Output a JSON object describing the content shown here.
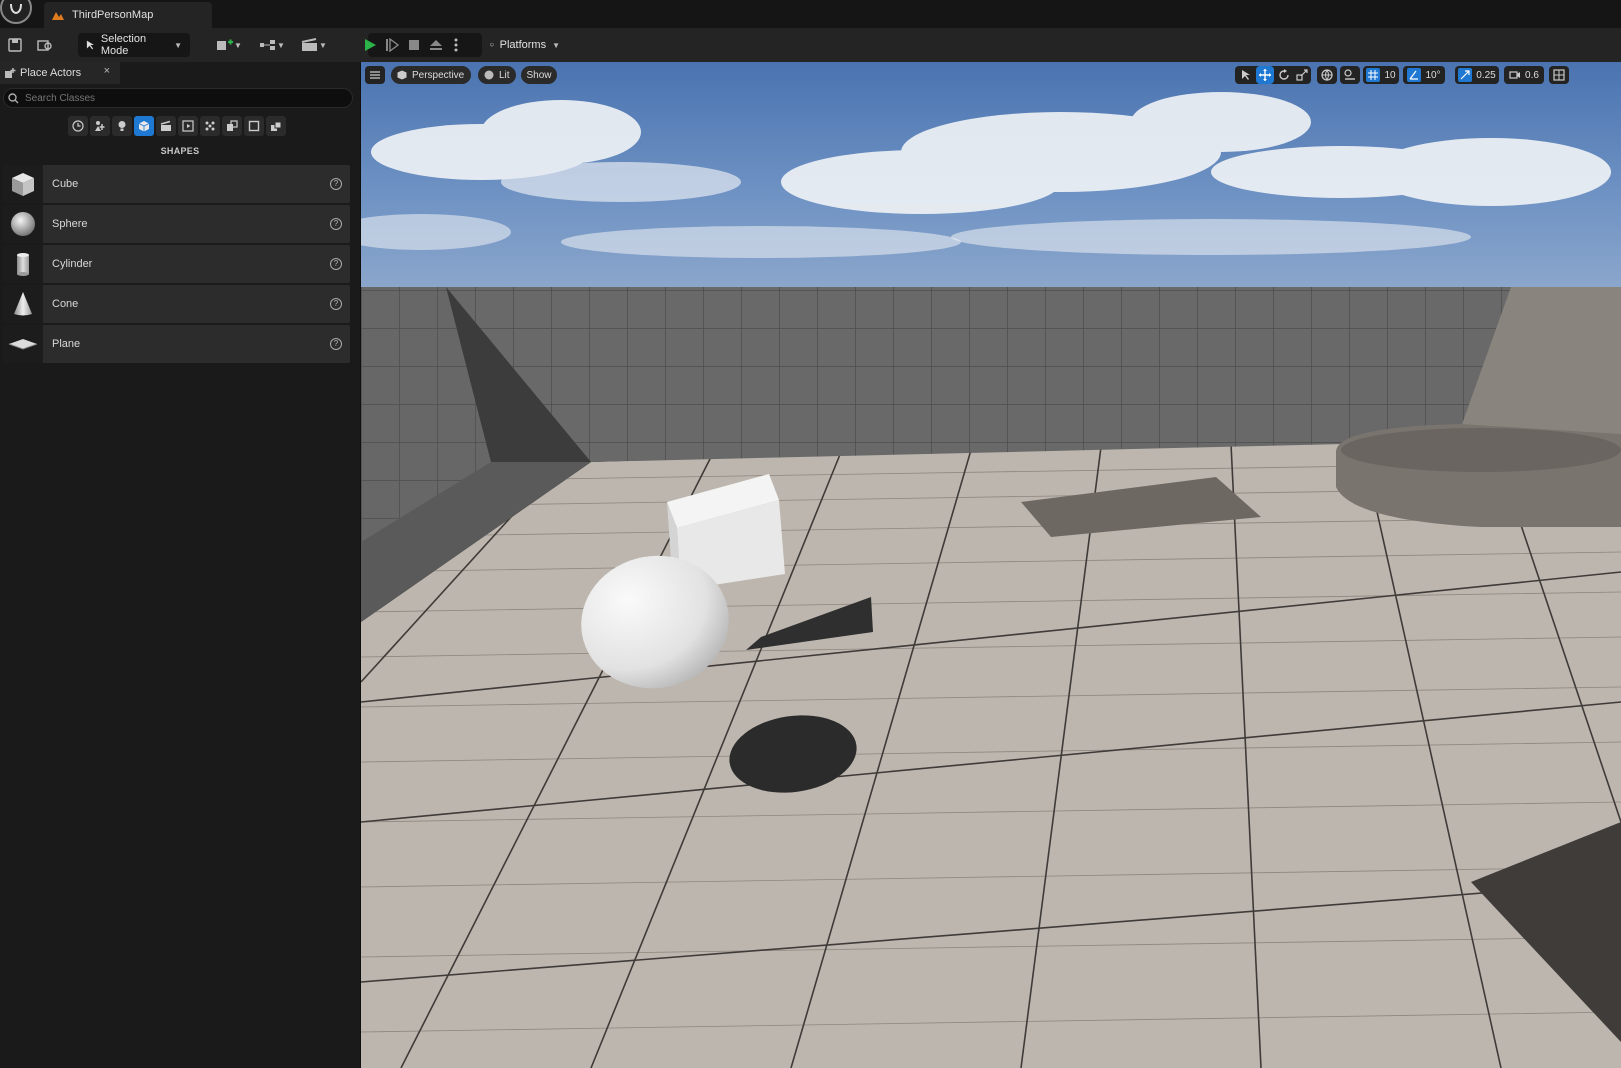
{
  "window": {
    "map_tab_title": "ThirdPersonMap"
  },
  "toolbar": {
    "selection_mode_label": "Selection Mode",
    "platforms_label": "Platforms"
  },
  "place_actors": {
    "tab_label": "Place Actors",
    "close_glyph": "×",
    "search_placeholder": "Search Classes",
    "section_title": "SHAPES",
    "categories": [
      "recently-placed",
      "basic",
      "lights",
      "shapes",
      "cinematic",
      "visual-effects",
      "volumes",
      "all-classes",
      "geometry",
      "extra"
    ],
    "active_category": "shapes",
    "items": [
      {
        "label": "Cube",
        "icon": "cube-icon"
      },
      {
        "label": "Sphere",
        "icon": "sphere-icon"
      },
      {
        "label": "Cylinder",
        "icon": "cylinder-icon"
      },
      {
        "label": "Cone",
        "icon": "cone-icon"
      },
      {
        "label": "Plane",
        "icon": "plane-icon"
      }
    ],
    "help_glyph": "?"
  },
  "viewport": {
    "view_mode_label": "Perspective",
    "lighting_label": "Lit",
    "show_label": "Show",
    "grid_snap_value": "10",
    "rotation_snap_value": "10°",
    "scale_snap_value": "0.25",
    "camera_speed_value": "0.6"
  },
  "colors": {
    "accent": "#1f78d1",
    "play_green": "#2bb34a",
    "panel_bg": "#1a1a1a",
    "toolbar_bg": "#242424"
  }
}
